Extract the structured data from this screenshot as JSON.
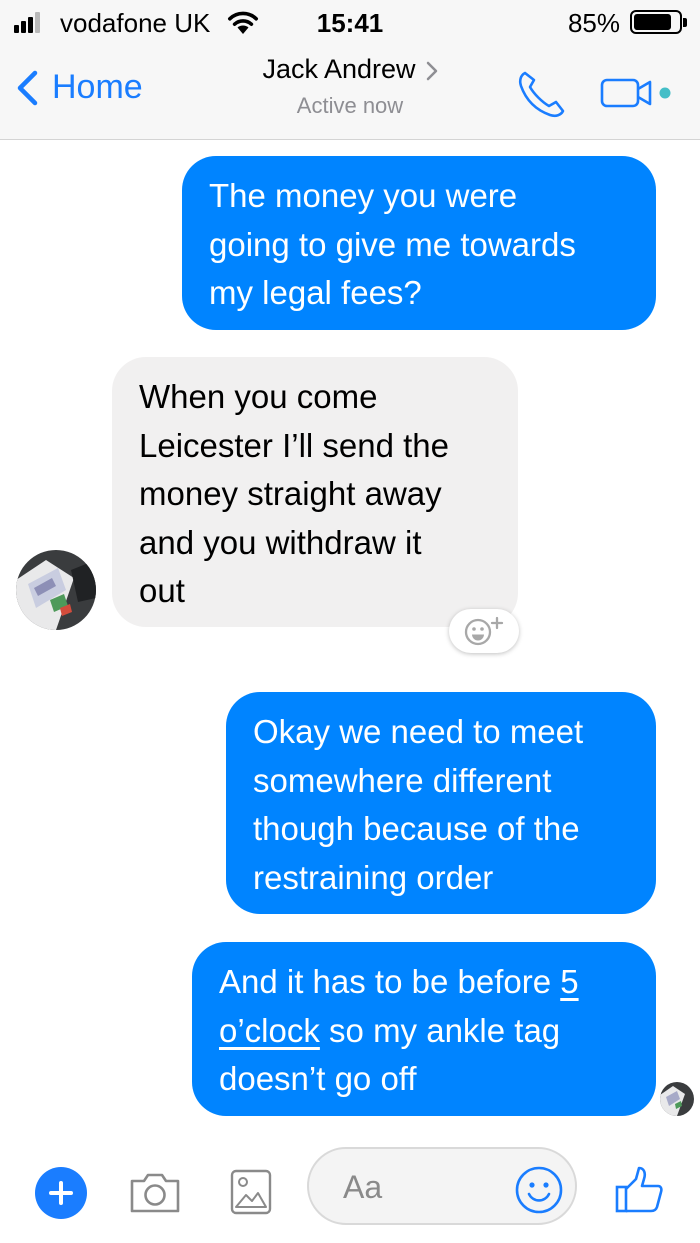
{
  "status_bar": {
    "carrier": "vodafone UK",
    "time": "15:41",
    "battery": "85%",
    "battery_level": 0.85,
    "signal_bars": 3
  },
  "header": {
    "back_label": "Home",
    "contact_name": "Jack Andrew",
    "status": "Active now",
    "accent_color": "#1a7dff",
    "online_dot_color": "#44bec7"
  },
  "messages": [
    {
      "direction": "outgoing",
      "lines": [
        "The money you were",
        "going to give me towards",
        "my legal fees?"
      ]
    },
    {
      "direction": "incoming",
      "lines": [
        "When you come",
        "Leicester I’ll send the",
        "money straight away",
        "and you withdraw it",
        "out"
      ]
    },
    {
      "direction": "outgoing",
      "lines": [
        "Okay we need to meet",
        "somewhere different",
        "though because of the",
        "restraining order"
      ]
    },
    {
      "direction": "outgoing",
      "parts": [
        "And it has to be before ",
        "5",
        "o’clock",
        " so my ankle tag",
        "doesn’t go off"
      ]
    }
  ],
  "colors": {
    "outgoing_bubble": "#0084ff",
    "incoming_bubble": "#f1f0f0"
  },
  "icons": {
    "composer": [
      "plus-icon",
      "camera-icon",
      "image-icon",
      "smiley-icon",
      "thumbs-up-icon"
    ],
    "header": [
      "chevron-left-icon",
      "chevron-right-icon",
      "phone-icon",
      "video-camera-icon"
    ],
    "reaction": "add-reaction-icon"
  },
  "composer": {
    "placeholder": "Aa"
  }
}
